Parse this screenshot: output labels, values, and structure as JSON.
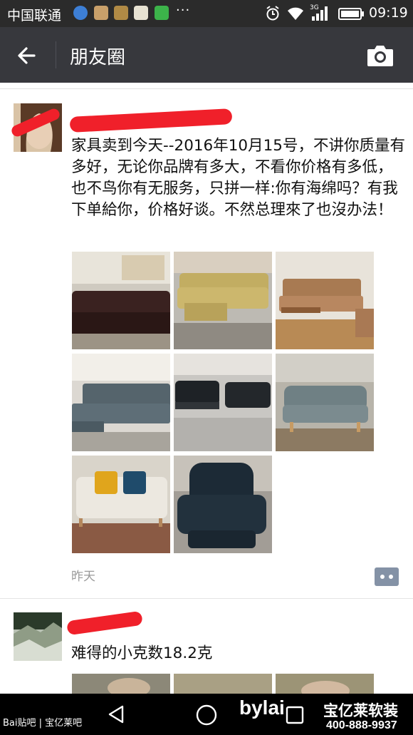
{
  "status_bar": {
    "carrier": "中国联通",
    "more": "···",
    "network": "3G",
    "time": "09:19"
  },
  "header": {
    "title": "朋友圈"
  },
  "posts": [
    {
      "text": "家具卖到今天--2016年10月15号，不讲你质量有多好，无论你品牌有多大，不看你价格有多低，也不鸟你有无服务，只拼一样:你有海绵吗？有我下单給你，价格好谈。不然总理來了也沒办法！",
      "time": "昨天",
      "photos": [
        "sofa-photo-1",
        "sofa-photo-2",
        "sofa-photo-3",
        "sofa-photo-4",
        "sofa-photo-5",
        "sofa-photo-6",
        "sofa-photo-7",
        "sofa-photo-8"
      ]
    },
    {
      "text": "难得的小克数18.2克"
    }
  ],
  "watermark": {
    "baidu": "Bai贴吧 | 宝亿莱吧",
    "brand": "bylai",
    "brand_cn": "宝亿莱软装",
    "phone": "400-888-9937"
  },
  "colors": {
    "status_bar": "#2b2b2b",
    "title_bar": "#37383d",
    "redaction": "#f0202a"
  }
}
